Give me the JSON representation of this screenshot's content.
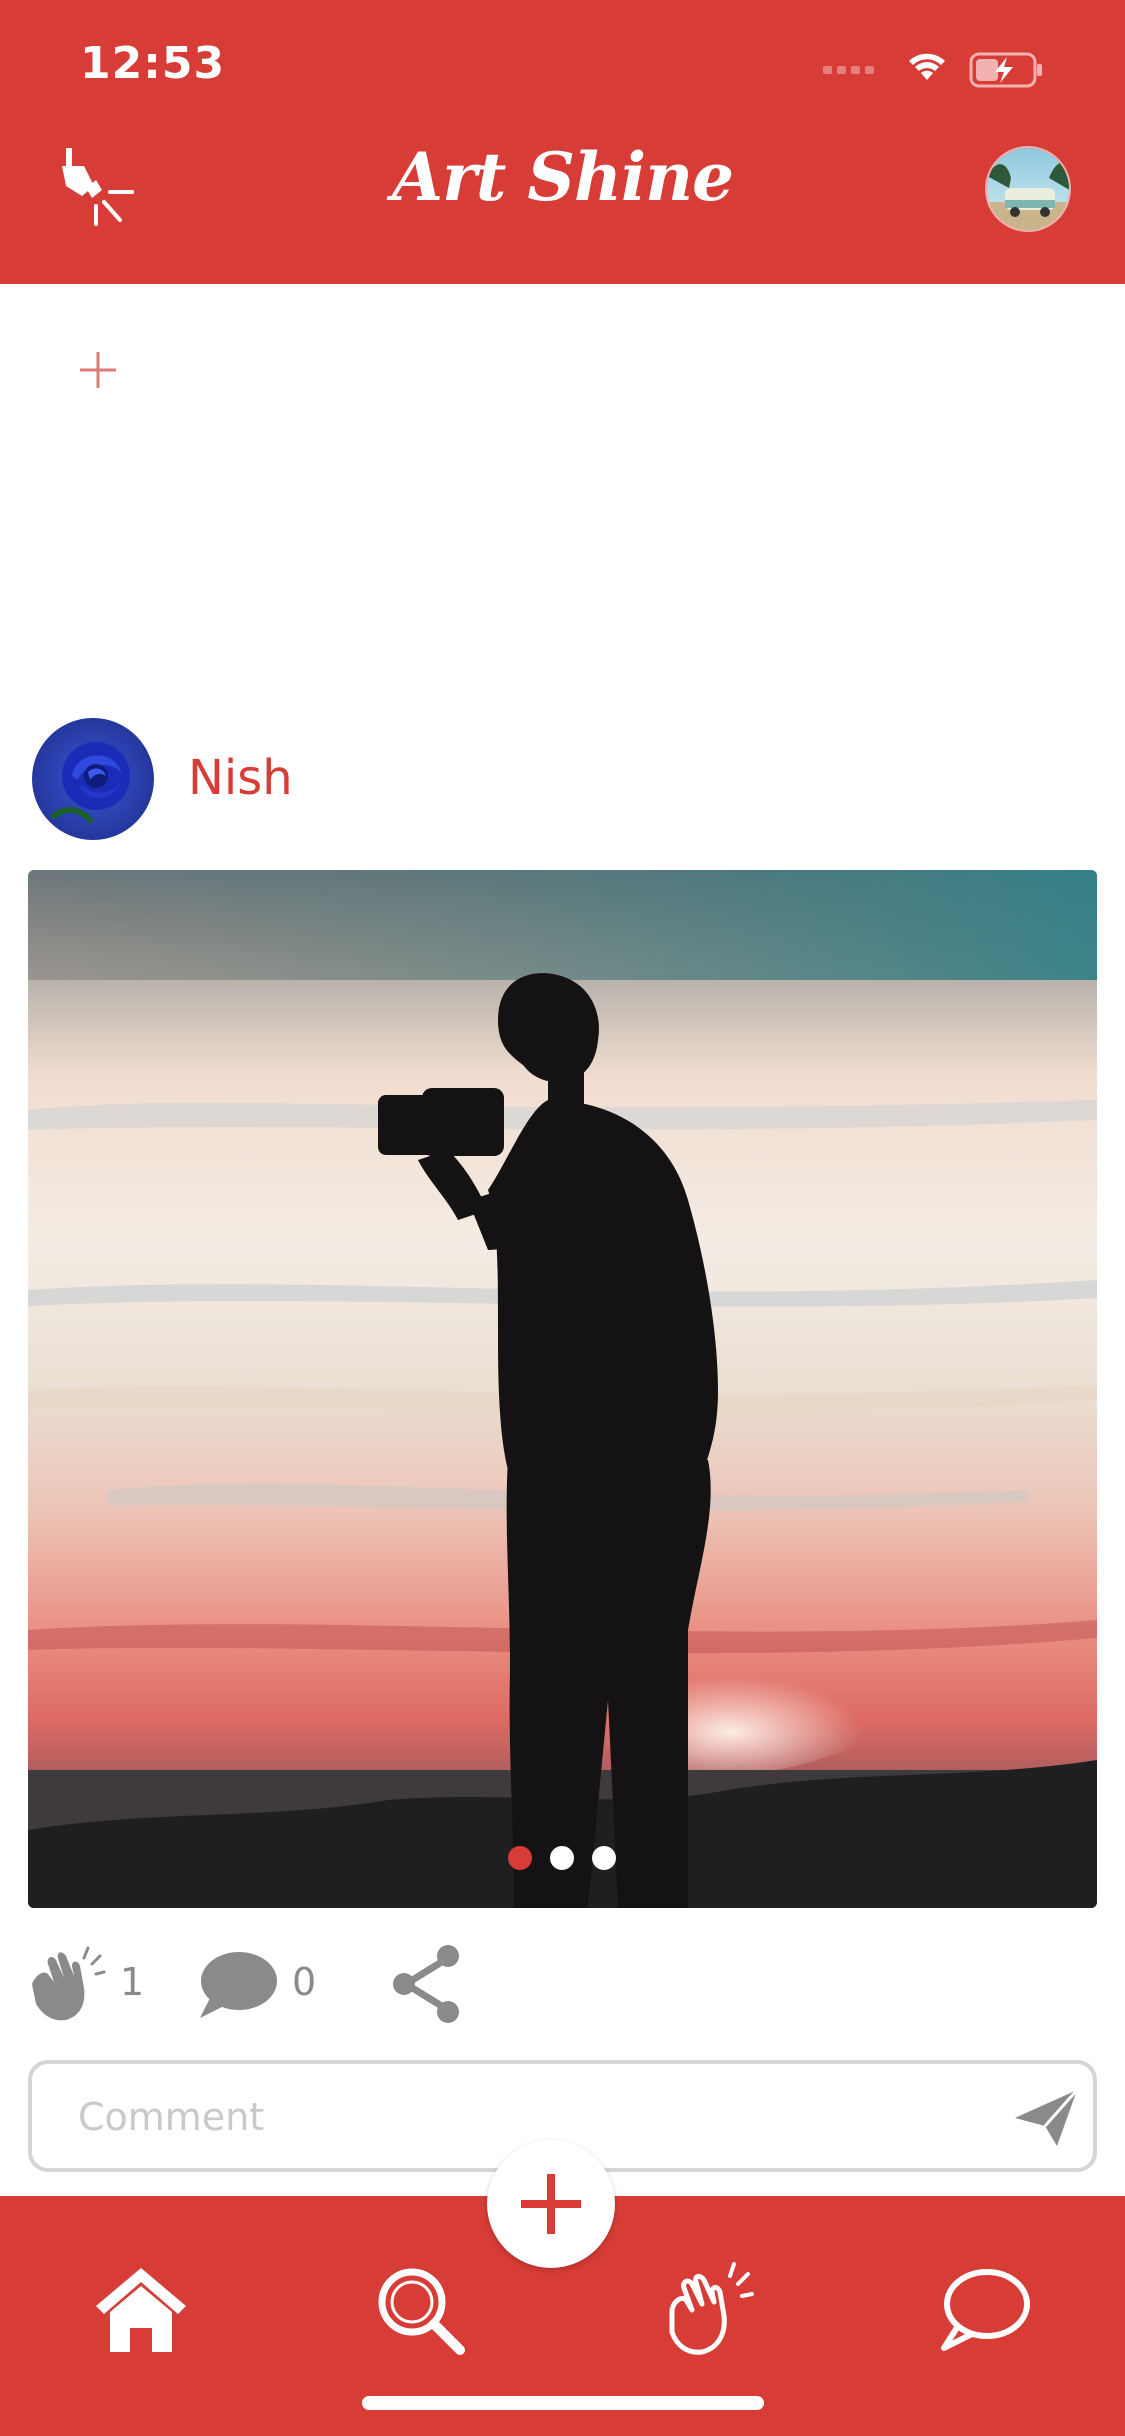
{
  "status_bar": {
    "time": "12:53"
  },
  "header": {
    "title": "Art Shine"
  },
  "post": {
    "username": "Nish",
    "image_page_count": 3,
    "active_image_index": 0,
    "claps": "1",
    "comments": "0"
  },
  "comment": {
    "placeholder": "Comment"
  },
  "icons": {
    "spotlight": "spotlight-icon",
    "add_story": "plus-icon",
    "clap": "clap-icon",
    "comment": "comment-bubble-icon",
    "share": "share-icon",
    "send": "send-icon",
    "fab": "plus-icon",
    "home": "home-icon",
    "search": "search-icon",
    "nav_clap": "clap-icon",
    "chat": "chat-bubble-icon"
  },
  "colors": {
    "brand": "#d73c36",
    "muted": "#8a8a8a",
    "border": "#d5d5d5"
  }
}
